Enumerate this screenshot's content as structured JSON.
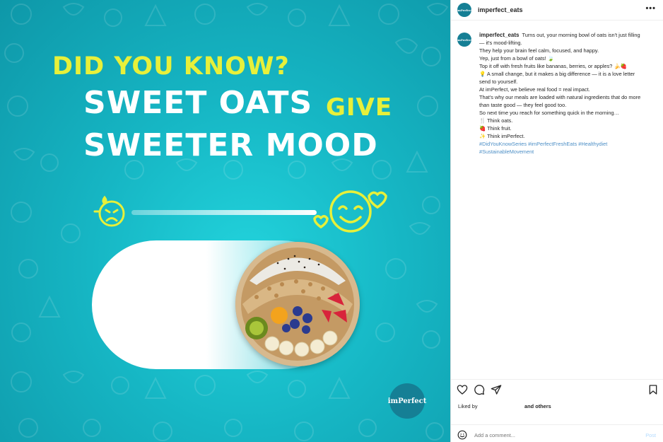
{
  "post_image": {
    "headline_line1": "DID YOU KNOW?",
    "headline_line2": "SWEET OATS",
    "headline_line2_accent": "GIVE",
    "headline_line3": "SWEETER MOOD",
    "brand_badge": "imPerfect",
    "colors": {
      "background": "#16b6c4",
      "accent_yellow": "#e7f03a",
      "badge": "#157f95"
    }
  },
  "header": {
    "username": "imperfect_eats",
    "more_icon": "more-horizontal-icon"
  },
  "caption": {
    "username": "imperfect_eats",
    "lines": [
      "Turns out, your morning bowl of oats isn't just filling",
      "— it's mood-lifting.",
      "They help your brain feel calm, focused, and happy.",
      "Yep, just from a bowl of oats! 🍃",
      "Top it off with fresh fruits like bananas, berries, or apples? 🍌🍓",
      "💡 A small change, but it makes a big difference — it is a love letter",
      "send to yourself.",
      "At imPerfect, we believe real food = real impact.",
      "That's why our meals are loaded with natural ingredients that do more",
      "than taste good — they feel good too.",
      "So next time you reach for something quick in the morning…",
      "🍴 Think oats.",
      "🍓 Think fruit.",
      "✨ Think imPerfect."
    ],
    "hashtags_line1": "#DidYouKnowSeries #imPerfectFreshEats #Healthydiet",
    "hashtags_line2": "#SustainableMovement"
  },
  "actions": {
    "like_icon": "heart-icon",
    "comment_icon": "comment-icon",
    "share_icon": "share-icon",
    "save_icon": "bookmark-icon"
  },
  "likes": {
    "prefix": "Liked by",
    "suffix": "and others"
  },
  "comment_box": {
    "emoji_icon": "emoji-icon",
    "placeholder": "Add a comment...",
    "post_label": "Post"
  }
}
